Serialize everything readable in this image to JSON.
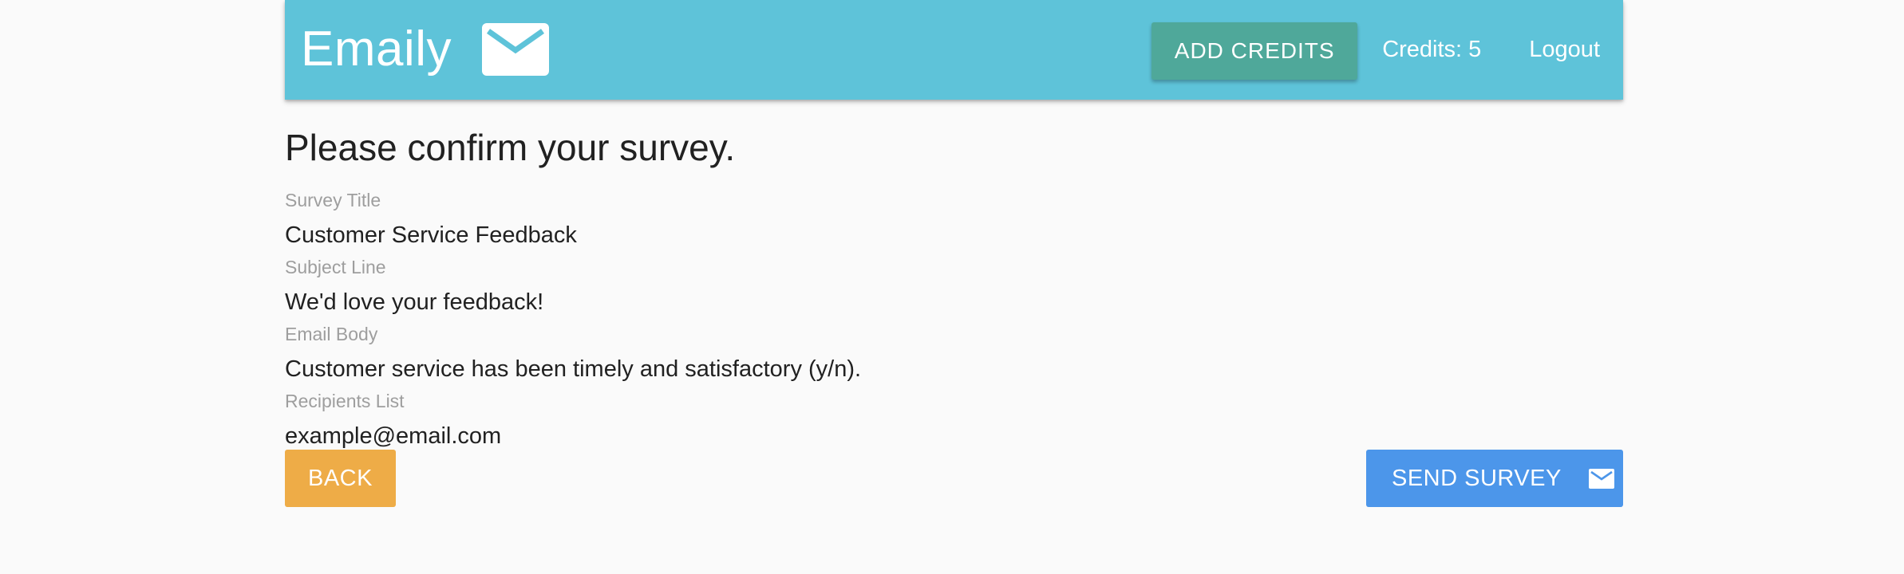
{
  "navbar": {
    "brand": "Emaily",
    "brand_icon": "mail-icon",
    "add_credits_label": "ADD CREDITS",
    "credits_text": "Credits: 5",
    "logout_label": "Logout",
    "colors": {
      "navbar_bg": "#5ec3d9",
      "add_credits_bg": "#4fa89a"
    }
  },
  "review": {
    "title": "Please confirm your survey.",
    "fields": [
      {
        "label": "Survey Title",
        "value": "Customer Service Feedback"
      },
      {
        "label": "Subject Line",
        "value": "We'd love your feedback!"
      },
      {
        "label": "Email Body",
        "value": "Customer service has been timely and satisfactory (y/n)."
      },
      {
        "label": "Recipients List",
        "value": "example@email.com"
      }
    ]
  },
  "actions": {
    "back_label": "BACK",
    "send_label": "SEND SURVEY",
    "send_icon": "mail-icon",
    "colors": {
      "back_bg": "#eeac47",
      "send_bg": "#4c96ea"
    }
  }
}
